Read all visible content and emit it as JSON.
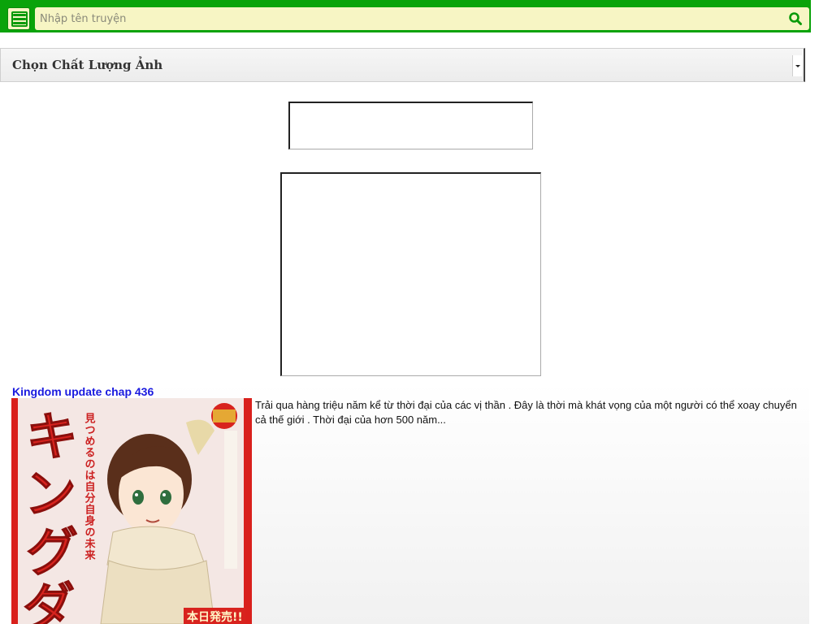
{
  "search": {
    "placeholder": "Nhập tên truyện",
    "value": ""
  },
  "quality_select": {
    "selected": "Chọn Chất Lượng Ảnh"
  },
  "story": {
    "title": "Kingdom update chap 436",
    "description": "Trải qua hàng triệu năm kể từ thời đại của các vị thần . Đây là thời mà khát vọng của một người có thể xoay chuyển cả thế giới . Thời đại của hơn 500 năm...",
    "cover": {
      "title_glyphs": [
        "キ",
        "ン",
        "グ",
        "ダ"
      ],
      "tagline": "見つめるのは自分自身の未来",
      "banner": "本日発売!!"
    }
  },
  "icons": {
    "menu": "hamburger-menu-icon",
    "search": "search-icon"
  },
  "colors": {
    "topbar": "#0aa30a",
    "search_bg": "#f7f5c4",
    "link": "#1a1adf"
  }
}
